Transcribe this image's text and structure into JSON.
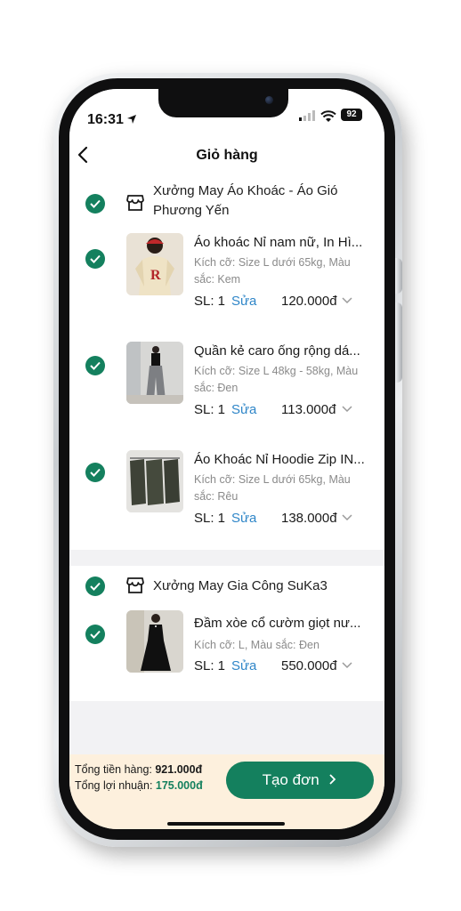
{
  "status": {
    "time": "16:31",
    "battery": "92"
  },
  "header": {
    "title": "Giỏ hàng"
  },
  "shops": [
    {
      "name": "Xưởng May Áo Khoác - Áo Gió Phương Yến",
      "items": [
        {
          "title": "Áo khoác Nỉ nam nữ, In Hì...",
          "variant": "Kích cỡ: Size L dưới 65kg, Màu sắc: Kem",
          "qty": "SL: 1",
          "edit": "Sửa",
          "price": "120.000đ"
        },
        {
          "title": "Quần kẻ caro ống rộng dá...",
          "variant": "Kích cỡ: Size L 48kg - 58kg, Màu sắc: Đen",
          "qty": "SL: 1",
          "edit": "Sửa",
          "price": "113.000đ"
        },
        {
          "title": "Áo Khoác Nỉ Hoodie Zip IN...",
          "variant": "Kích cỡ: Size L dưới 65kg, Màu sắc: Rêu",
          "qty": "SL: 1",
          "edit": "Sửa",
          "price": "138.000đ"
        }
      ]
    },
    {
      "name": "Xưởng May Gia Công SuKa3",
      "items": [
        {
          "title": "Đầm xòe cổ cườm giọt nư...",
          "variant": "Kích cỡ: L, Màu sắc: Đen",
          "qty": "SL: 1",
          "edit": "Sửa",
          "price": "550.000đ"
        }
      ]
    }
  ],
  "footer": {
    "total_label": "Tổng tiền hàng:",
    "total_value": "921.000đ",
    "profit_label": "Tổng lợi nhuận:",
    "profit_value": "175.000đ",
    "create_button": "Tạo đơn"
  },
  "colors": {
    "accent": "#14805e",
    "link": "#2f86c8",
    "footer_bg": "#fdf0dd"
  },
  "icons": [
    "location-arrow-icon",
    "signal-icon",
    "wifi-icon",
    "back-icon",
    "check-icon",
    "store-icon",
    "chevron-down-icon",
    "chevron-right-icon"
  ]
}
